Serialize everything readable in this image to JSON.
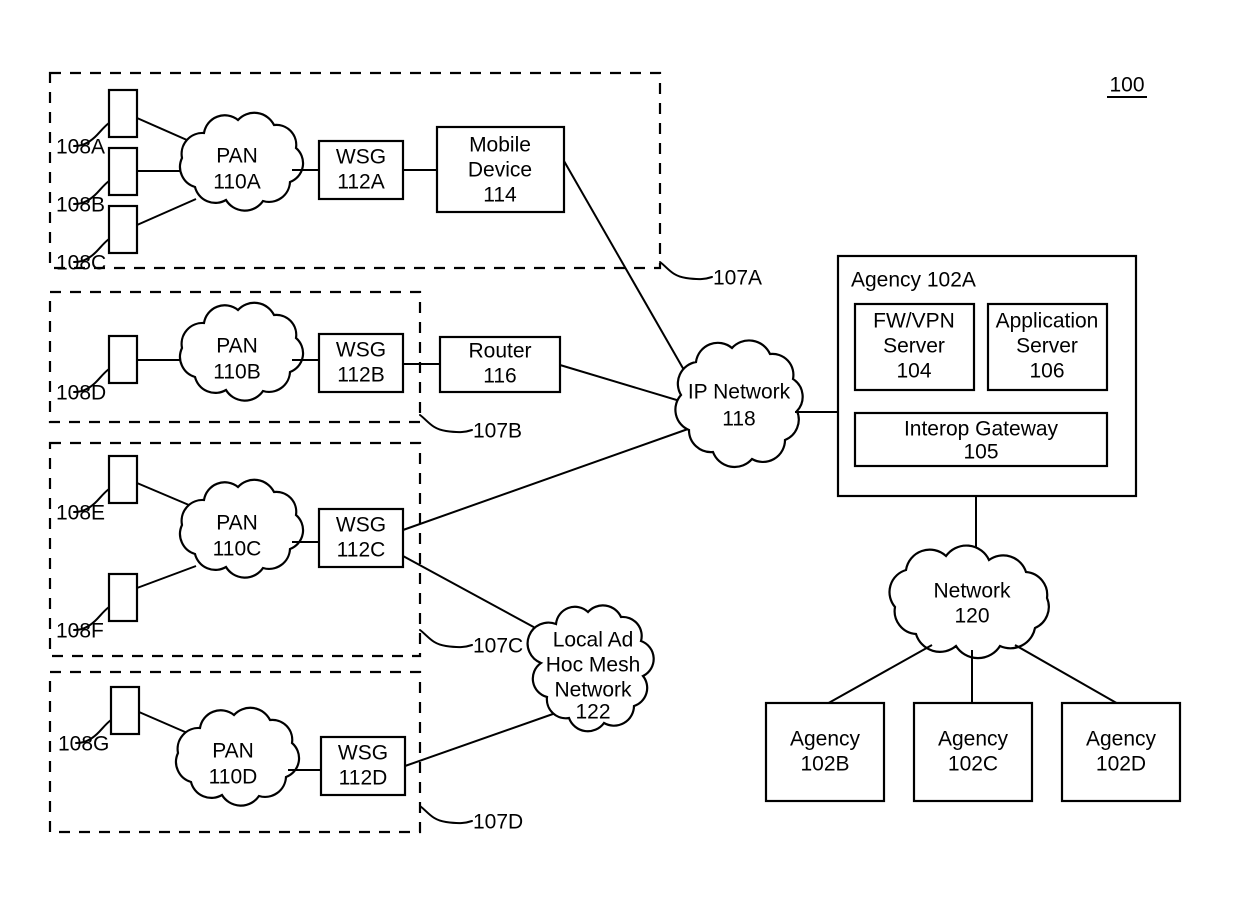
{
  "figure": {
    "number": "100",
    "underlined": true
  },
  "groups": [
    {
      "id": "107A",
      "label": "107A"
    },
    {
      "id": "107B",
      "label": "107B"
    },
    {
      "id": "107C",
      "label": "107C"
    },
    {
      "id": "107D",
      "label": "107D"
    }
  ],
  "devices": [
    {
      "id": "108A",
      "label": "108A",
      "group": "107A"
    },
    {
      "id": "108B",
      "label": "108B",
      "group": "107A"
    },
    {
      "id": "108C",
      "label": "108C",
      "group": "107A"
    },
    {
      "id": "108D",
      "label": "108D",
      "group": "107B"
    },
    {
      "id": "108E",
      "label": "108E",
      "group": "107C"
    },
    {
      "id": "108F",
      "label": "108F",
      "group": "107C"
    },
    {
      "id": "108G",
      "label": "108G",
      "group": "107D"
    }
  ],
  "pans": [
    {
      "id": "110A",
      "line1": "PAN",
      "line2": "110A"
    },
    {
      "id": "110B",
      "line1": "PAN",
      "line2": "110B"
    },
    {
      "id": "110C",
      "line1": "PAN",
      "line2": "110C"
    },
    {
      "id": "110D",
      "line1": "PAN",
      "line2": "110D"
    }
  ],
  "gateways": [
    {
      "id": "112A",
      "line1": "WSG",
      "line2": "112A"
    },
    {
      "id": "112B",
      "line1": "WSG",
      "line2": "112B"
    },
    {
      "id": "112C",
      "line1": "WSG",
      "line2": "112C"
    },
    {
      "id": "112D",
      "line1": "WSG",
      "line2": "112D"
    }
  ],
  "mobile_device": {
    "line1": "Mobile",
    "line2": "Device",
    "line3": "114"
  },
  "router": {
    "line1": "Router",
    "line2": "116"
  },
  "ip_network": {
    "line1": "IP Network",
    "line2": "118"
  },
  "mesh_network": {
    "line1": "Local Ad",
    "line2": "Hoc Mesh",
    "line3": "Network",
    "line4": "122"
  },
  "core_network": {
    "line1": "Network",
    "line2": "120"
  },
  "agency_primary": {
    "title": "Agency 102A",
    "fw_vpn_server": {
      "line1": "FW/VPN",
      "line2": "Server",
      "line3": "104"
    },
    "application_server": {
      "line1": "Application",
      "line2": "Server",
      "line3": "106"
    },
    "interop_gateway": {
      "line1": "Interop Gateway",
      "line2": "105"
    }
  },
  "agencies": [
    {
      "id": "102B",
      "line1": "Agency",
      "line2": "102B"
    },
    {
      "id": "102C",
      "line1": "Agency",
      "line2": "102C"
    },
    {
      "id": "102D",
      "line1": "Agency",
      "line2": "102D"
    }
  ],
  "colors": {
    "stroke": "#000000",
    "fill": "#ffffff"
  }
}
